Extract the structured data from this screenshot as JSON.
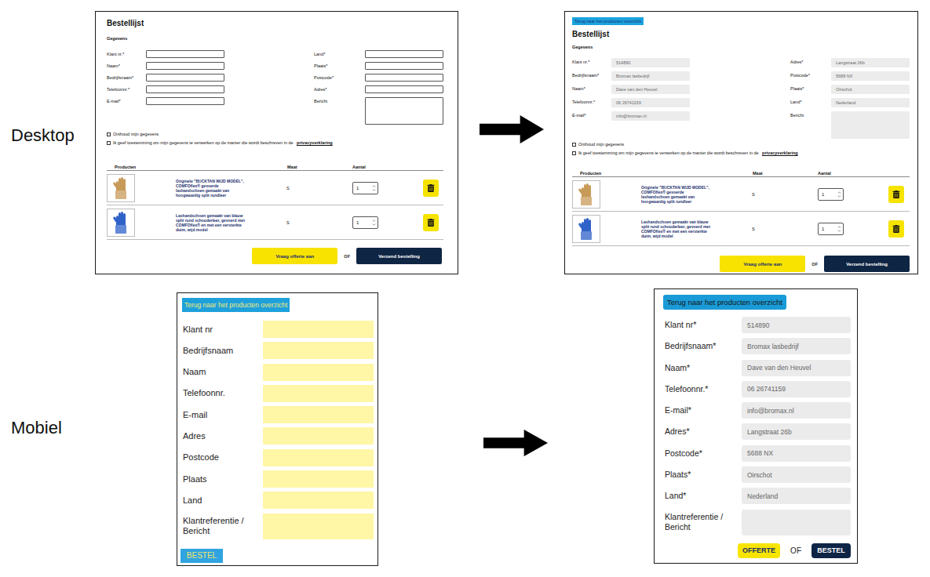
{
  "labels": {
    "desktop": "Desktop",
    "mobile": "Mobiel"
  },
  "desktop_before": {
    "title": "Bestellijst",
    "section": "Gegevens",
    "fields_filled": false,
    "fields_left": [
      {
        "label": "Klant nr.*",
        "value": "",
        "kind": "input"
      },
      {
        "label": "Naam*",
        "value": "",
        "kind": "input"
      },
      {
        "label": "Bedrijfsnaam*",
        "value": "",
        "kind": "input"
      },
      {
        "label": "Telefoonnr.*",
        "value": "",
        "kind": "input"
      },
      {
        "label": "E-mail*",
        "value": "",
        "kind": "input"
      }
    ],
    "fields_right": [
      {
        "label": "Land*",
        "value": "",
        "kind": "input"
      },
      {
        "label": "Plaats*",
        "value": "",
        "kind": "input"
      },
      {
        "label": "Postcode*",
        "value": "",
        "kind": "input"
      },
      {
        "label": "Adres*",
        "value": "",
        "kind": "input"
      },
      {
        "label": "Bericht",
        "value": "",
        "kind": "textarea"
      }
    ],
    "checkboxes": [
      {
        "label": "Onthoud mijn gegevens",
        "link": "",
        "checked": false
      },
      {
        "label": "Ik geef toestemming om mijn gegevens te verwerken op de manier die wordt beschreven in de",
        "link": "privacyverklaring",
        "checked": false
      }
    ],
    "columns": [
      "Producten",
      "Maat",
      "Aantal"
    ],
    "products": [
      {
        "description": "Originele \"BUCKTAN WIJD MODEL\", COMFOflex® gevoerde lashandschoen gemaakt van hoogwaardig split rundleer",
        "size": "S",
        "quantity": "1",
        "color": "#c89a58"
      },
      {
        "description": "Lashandschoen gemaakt van blauw split rund schouderleer, gevoerd met COMFOflex® en met een versterkte duim, wijd model",
        "size": "S",
        "quantity": "1",
        "color": "#2f62c8"
      }
    ],
    "buttons": [
      {
        "label": "Vraag offerte aan",
        "kind": "quote"
      },
      {
        "label": "OF",
        "kind": "or"
      },
      {
        "label": "Verzend bestelling",
        "kind": "order"
      }
    ]
  },
  "desktop_after": {
    "back_button": "Terug naar het producten overzicht",
    "title": "Bestellijst",
    "section": "Gegevens",
    "fields_filled": true,
    "fields_left": [
      {
        "label": "Klant nr.*",
        "value": "514890",
        "kind": "input"
      },
      {
        "label": "Bedrijfsnaam*",
        "value": "Bromax lasbedrijf",
        "kind": "input"
      },
      {
        "label": "Naam*",
        "value": "Dave van den Heuvel",
        "kind": "input"
      },
      {
        "label": "Telefoonnr.*",
        "value": "06 26741159",
        "kind": "input"
      },
      {
        "label": "E-mail*",
        "value": "info@bromax.nl",
        "kind": "input"
      }
    ],
    "fields_right": [
      {
        "label": "Adres*",
        "value": "Langstraat 26b",
        "kind": "input"
      },
      {
        "label": "Postcode*",
        "value": "5688 NX",
        "kind": "input"
      },
      {
        "label": "Plaats*",
        "value": "Oirschot",
        "kind": "input"
      },
      {
        "label": "Land*",
        "value": "Nederland",
        "kind": "input"
      },
      {
        "label": "Bericht",
        "value": "",
        "kind": "textarea"
      }
    ],
    "checkboxes": [
      {
        "label": "Onthoud mijn gegevens",
        "link": "",
        "checked": false
      },
      {
        "label": "Ik geef toestemming om mijn gegevens te verwerken op de manier die wordt beschreven in de",
        "link": "privacyverklaring",
        "checked": false
      }
    ],
    "columns": [
      "Producten",
      "Maat",
      "Aantal"
    ],
    "products": [
      {
        "description": "Originele \"BUCKTAN WIJD MODEL\", COMFOflex® gevoerde lashandschoen gemaakt van hoogwaardig split rundleer",
        "size": "S",
        "quantity": "1",
        "color": "#c89a58"
      },
      {
        "description": "Lashandschoen gemaakt van blauw split rund schouderleer, gevoerd met COMFOflex® en met een versterkte duim, wijd model",
        "size": "S",
        "quantity": "1",
        "color": "#2f62c8"
      }
    ],
    "buttons": [
      {
        "label": "Vraag offerte aan",
        "kind": "quote"
      },
      {
        "label": "OF",
        "kind": "or"
      },
      {
        "label": "Verzend bestelling",
        "kind": "order"
      }
    ]
  },
  "mobile_before": {
    "back_button": "Terug naar het producten overzicht",
    "fields_filled": false,
    "fields": [
      {
        "label": "Klant nr",
        "value": "",
        "kind": "input"
      },
      {
        "label": "Bedrijfsnaam",
        "value": "",
        "kind": "input"
      },
      {
        "label": "Naam",
        "value": "",
        "kind": "input"
      },
      {
        "label": "Telefoonnr.",
        "value": "",
        "kind": "input"
      },
      {
        "label": "E-mail",
        "value": "",
        "kind": "input"
      },
      {
        "label": "Adres",
        "value": "",
        "kind": "input"
      },
      {
        "label": "Postcode",
        "value": "",
        "kind": "input"
      },
      {
        "label": "Plaats",
        "value": "",
        "kind": "input"
      },
      {
        "label": "Land",
        "value": "",
        "kind": "input"
      },
      {
        "label": "Klantreferentie / Bericht",
        "value": "",
        "kind": "textarea"
      }
    ],
    "buttons": [
      {
        "label": "BESTEL",
        "kind": "draft"
      }
    ]
  },
  "mobile_after": {
    "back_button": "Terug naar het producten overzicht",
    "fields_filled": true,
    "fields": [
      {
        "label": "Klant nr*",
        "value": "514890",
        "kind": "input"
      },
      {
        "label": "Bedrijfsnaam*",
        "value": "Bromax lasbedrijf",
        "kind": "input"
      },
      {
        "label": "Naam*",
        "value": "Dave van den Heuvel",
        "kind": "input"
      },
      {
        "label": "Telefoonnr.*",
        "value": "06 26741159",
        "kind": "input"
      },
      {
        "label": "E-mail*",
        "value": "info@bromax.nl",
        "kind": "input"
      },
      {
        "label": "Adres*",
        "value": "Langstraat 26b",
        "kind": "input"
      },
      {
        "label": "Postcode*",
        "value": "5688 NX",
        "kind": "input"
      },
      {
        "label": "Plaats*",
        "value": "Oirschot",
        "kind": "input"
      },
      {
        "label": "Land*",
        "value": "Nederland",
        "kind": "input"
      },
      {
        "label": "Klantreferentie / Bericht",
        "value": "",
        "kind": "textarea"
      }
    ],
    "buttons": [
      {
        "label": "OFFERTE",
        "kind": "quote"
      },
      {
        "label": "OF",
        "kind": "or"
      },
      {
        "label": "BESTEL",
        "kind": "order"
      }
    ]
  }
}
